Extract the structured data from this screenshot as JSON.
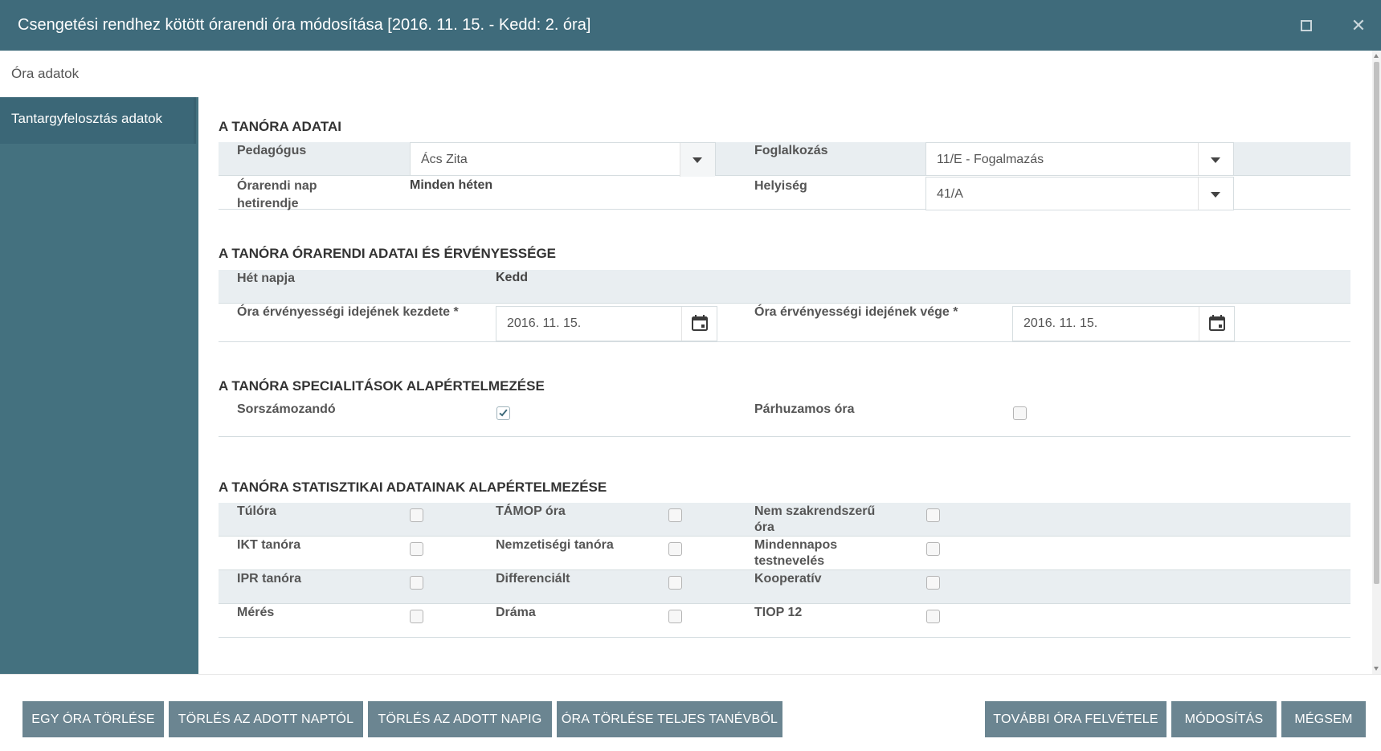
{
  "window": {
    "title": "Csengetési rendhez kötött órarendi óra módosítása [2016. 11. 15. - Kedd: 2. óra]"
  },
  "tabs": {
    "top": "Óra adatok",
    "side": "Tantargyfelosztás adatok"
  },
  "section1": {
    "title": "A TANÓRA ADATAI",
    "pedagogus_label": "Pedagógus",
    "pedagogus_value": "Ács Zita",
    "foglalkozas_label": "Foglalkozás",
    "foglalkozas_value": "11/E - Fogalmazás",
    "hetirend_label_1": "Órarendi nap",
    "hetirend_label_2": "hetirendje",
    "hetirend_value": "Minden héten",
    "helyiseg_label": "Helyiség",
    "helyiseg_value": "41/A"
  },
  "section2": {
    "title": "A TANÓRA ÓRARENDI ADATAI ÉS ÉRVÉNYESSÉGE",
    "het_napja_label": "Hét napja",
    "het_napja_value": "Kedd",
    "kezdete_label": "Óra érvényességi idejének kezdete *",
    "kezdete_value": "2016. 11. 15.",
    "vege_label": "Óra érvényességi idejének vége *",
    "vege_value": "2016. 11. 15."
  },
  "section3": {
    "title": "A TANÓRA SPECIALITÁSOK ALAPÉRTELMEZÉSE",
    "sorszamozando_label": "Sorszámozandó",
    "sorszamozando_checked": true,
    "parhuzamos_label": "Párhuzamos óra",
    "parhuzamos_checked": false
  },
  "section4": {
    "title": "A TANÓRA STATISZTIKAI ADATAINAK ALAPÉRTELMEZÉSE",
    "rows": [
      [
        {
          "label": "Túlóra"
        },
        {
          "label": "TÁMOP óra"
        },
        {
          "label_1": "Nem szakrendszerű",
          "label_2": "óra"
        }
      ],
      [
        {
          "label": "IKT tanóra"
        },
        {
          "label": "Nemzetiségi tanóra"
        },
        {
          "label_1": "Mindennapos",
          "label_2": "testnevelés"
        }
      ],
      [
        {
          "label": "IPR tanóra"
        },
        {
          "label": "Differenciált"
        },
        {
          "label": "Kooperatív"
        }
      ],
      [
        {
          "label": "Mérés"
        },
        {
          "label": "Dráma"
        },
        {
          "label": "TIOP 12"
        }
      ]
    ]
  },
  "footer": {
    "egy_ora_torlese": "EGY ÓRA TÖRLÉSE",
    "torles_naptol": "TÖRLÉS AZ ADOTT NAPTÓL",
    "torles_napig": "TÖRLÉS AZ ADOTT NAPIG",
    "ora_torlese_tanevbol": "ÓRA TÖRLÉSE TELJES TANÉVBŐL",
    "tovabbi_ora": "TOVÁBBI ÓRA FELVÉTELE",
    "modositas": "MÓDOSÍTÁS",
    "megsem": "MÉGSEM"
  },
  "colors": {
    "titlebar": "#3f6b7b",
    "sidebar": "#44717f",
    "button": "#6b8591",
    "row_shade": "#e9eef1"
  }
}
